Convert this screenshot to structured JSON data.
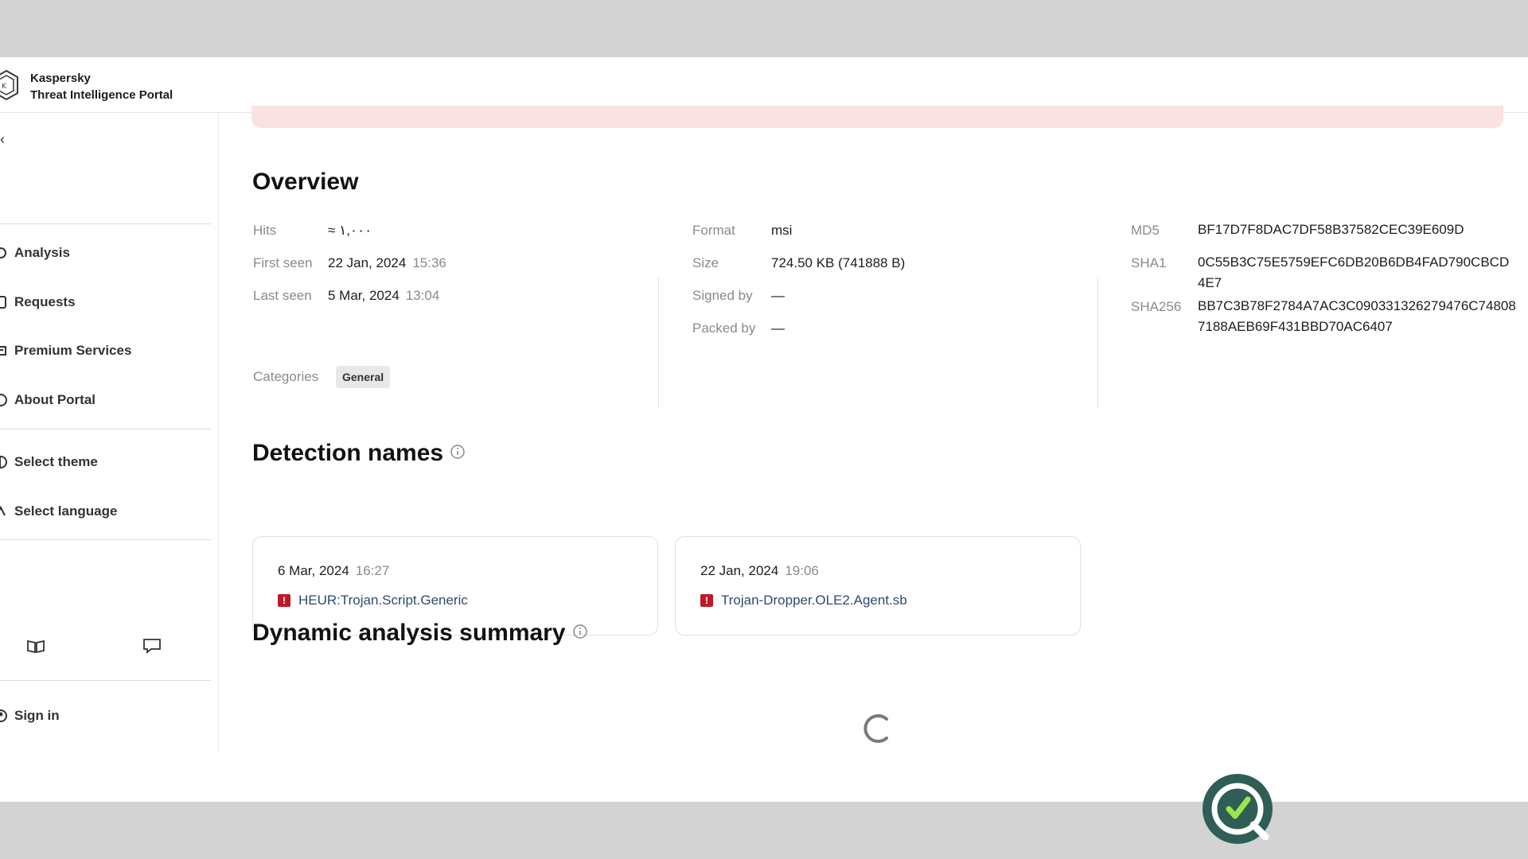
{
  "header": {
    "brand_line1": "Kaspersky",
    "brand_line2": "Threat Intelligence Portal"
  },
  "sidebar": {
    "collapse_glyph": "‹",
    "nav": [
      {
        "label": "Analysis",
        "icon": "analysis-icon"
      },
      {
        "label": "Requests",
        "icon": "requests-icon"
      },
      {
        "label": "Premium Services",
        "icon": "premium-icon"
      },
      {
        "label": "About Portal",
        "icon": "info-icon"
      }
    ],
    "settings": [
      {
        "label": "Select theme",
        "icon": "theme-icon"
      },
      {
        "label": "Select language",
        "icon": "language-icon"
      }
    ],
    "tools": [
      "book-icon",
      "chat-icon"
    ],
    "sign_in": "Sign in"
  },
  "overview": {
    "title": "Overview",
    "hits_label": "Hits",
    "hits_value": "≈ ١,٠٠٠",
    "first_seen_label": "First seen",
    "first_seen_date": "22 Jan, 2024",
    "first_seen_time": "15:36",
    "last_seen_label": "Last seen",
    "last_seen_date": "5 Mar, 2024",
    "last_seen_time": "13:04",
    "format_label": "Format",
    "format_value": "msi",
    "size_label": "Size",
    "size_value": "724.50 KB (741888 B)",
    "signed_label": "Signed by",
    "signed_value": "—",
    "packed_label": "Packed by",
    "packed_value": "—",
    "md5_label": "MD5",
    "md5_value": "BF17D7F8DAC7DF58B37582CEC39E609D",
    "sha1_label": "SHA1",
    "sha1_value": "0C55B3C75E5759EFC6DB20B6DB4FAD790CBCD4E7",
    "sha256_label": "SHA256",
    "sha256_value": "BB7C3B78F2784A7AC3C090331326279476C748087188AEB69F431BBD70AC6407",
    "categories_label": "Categories",
    "category_chip": "General"
  },
  "detections": {
    "title": "Detection names",
    "items": [
      {
        "date": "6 Mar, 2024",
        "time": "16:27",
        "name": "HEUR:Trojan.Script.Generic"
      },
      {
        "date": "22 Jan, 2024",
        "time": "19:06",
        "name": "Trojan-Dropper.OLE2.Agent.sb"
      }
    ]
  },
  "dynamic": {
    "title": "Dynamic analysis summary"
  },
  "colors": {
    "alert_bg": "#fbe2e2",
    "detection_flag": "#c0182b",
    "link": "#2e4a6b",
    "fab": "#2e5e55"
  }
}
